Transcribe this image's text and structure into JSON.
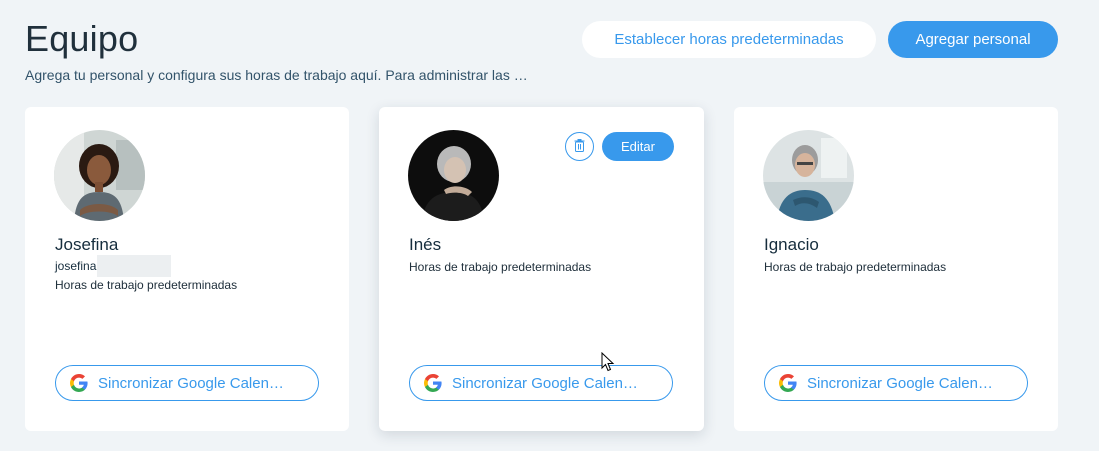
{
  "header": {
    "title": "Equipo",
    "subtitle": "Agrega tu personal y configura sus horas de trabajo aquí. Para administrar las …",
    "set_hours_label": "Establecer horas predeterminadas",
    "add_staff_label": "Agregar personal"
  },
  "staff": [
    {
      "name": "Josefina",
      "email": "josefina",
      "hours": "Horas de trabajo predeterminadas",
      "sync_label": "Sincronizar Google Calen…"
    },
    {
      "name": "Inés",
      "hours": "Horas de trabajo predeterminadas",
      "sync_label": "Sincronizar Google Calen…",
      "edit_label": "Editar"
    },
    {
      "name": "Ignacio",
      "hours": "Horas de trabajo predeterminadas",
      "sync_label": "Sincronizar Google Calen…"
    }
  ],
  "icons": {
    "delete": "trash-icon",
    "google": "google-g-icon",
    "cursor": "mouse-pointer-icon"
  },
  "colors": {
    "accent": "#3899ec",
    "background": "#f0f4f7",
    "text": "#162d3d"
  }
}
